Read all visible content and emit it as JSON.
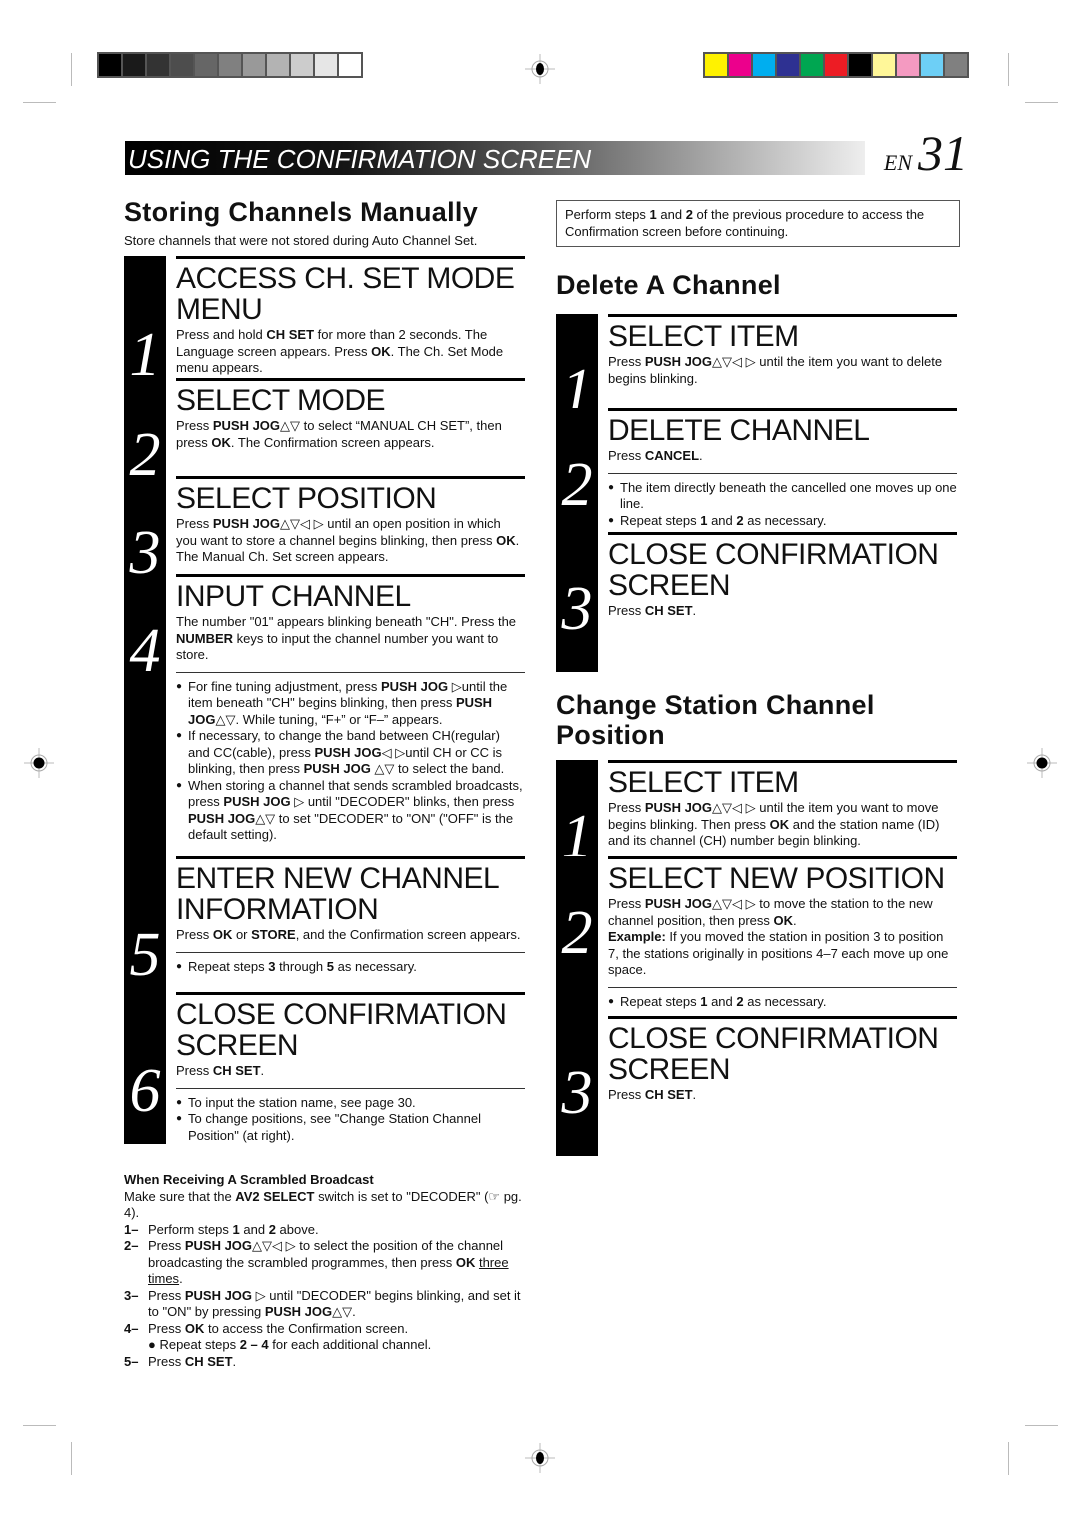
{
  "print_marks": {
    "gray_swatches": [
      "#000000",
      "#1a1a1a",
      "#333333",
      "#4d4d4d",
      "#666666",
      "#808080",
      "#999999",
      "#b3b3b3",
      "#cccccc",
      "#e6e6e6",
      "#ffffff"
    ],
    "color_swatches": [
      "#fff200",
      "#ec008c",
      "#00aeef",
      "#2e3192",
      "#00a651",
      "#ed1c24",
      "#000000",
      "#fff799",
      "#f49ac1",
      "#6dcff6",
      "#808080"
    ]
  },
  "header": {
    "section_title": "USING THE CONFIRMATION SCREEN",
    "lang": "EN",
    "page_number": "31"
  },
  "left": {
    "title": "Storing Channels Manually",
    "intro": "Store channels that were not stored during Auto Channel Set.",
    "steps": [
      {
        "num": "1",
        "title": "ACCESS CH. SET MODE MENU",
        "html": "Press and hold <b>CH SET</b> for more than 2 seconds. The Language screen appears. Press <b>OK</b>. The Ch. Set Mode menu appears."
      },
      {
        "num": "2",
        "title": "SELECT MODE",
        "html": "Press <b>PUSH JOG</b>△▽ to select “MANUAL CH SET”, then press <b>OK</b>. The Confirmation screen appears."
      },
      {
        "num": "3",
        "title": "SELECT POSITION",
        "html": "Press <b>PUSH JOG</b>△▽◁ ▷ until an open position in which you want to store a channel begins blinking, then press <b>OK</b>. The Manual Ch. Set screen appears."
      },
      {
        "num": "4",
        "title": "INPUT CHANNEL",
        "html": "The number \"01\" appears blinking beneath \"CH\". Press the <b>NUMBER</b> keys to input the channel number you want to store.",
        "bullets": [
          "For fine tuning adjustment, press <b>PUSH JOG</b> ▷until the item beneath \"CH\" begins blinking, then press <b>PUSH JOG</b>△▽. While tuning, “F+” or “F–” appears.",
          "If necessary, to change the band between CH(regular) and CC(cable), press <b>PUSH JOG</b>◁ ▷until CH or CC is blinking, then press <b>PUSH JOG</b> △▽ to select the band.",
          "When storing a channel that sends scrambled broadcasts, press <b>PUSH JOG</b> ▷ until \"DECODER\" blinks, then press <b>PUSH JOG</b>△▽ to set \"DECODER\" to \"ON\" (\"OFF\" is the default setting)."
        ]
      },
      {
        "num": "5",
        "title": "ENTER NEW CHANNEL INFORMATION",
        "html": "Press <b>OK</b> or <b>STORE</b>, and the Confirmation screen appears.",
        "bullets": [
          "Repeat steps <b>3</b> through <b>5</b> as necessary."
        ]
      },
      {
        "num": "6",
        "title": "CLOSE CONFIRMATION SCREEN",
        "html": "Press <b>CH SET</b>.",
        "bullets": [
          "To input the station name, see page 30.",
          "To change positions, see \"Change Station Channel Position\" (at right)."
        ]
      }
    ],
    "scrambled": {
      "title": "When Receiving A Scrambled Broadcast",
      "intro_html": "Make sure that the <b>AV2 SELECT</b> switch is set to \"DECODER\" (☞ pg. 4).",
      "items": [
        {
          "k": "1–",
          "html": "Perform steps <b>1</b> and <b>2</b> above."
        },
        {
          "k": "2–",
          "html": "Press <b>PUSH JOG</b>△▽◁ ▷ to select the position of the channel broadcasting the scrambled programmes, then press <b>OK</b> <u>three times</u>."
        },
        {
          "k": "3–",
          "html": "Press <b>PUSH JOG</b> ▷ until \"DECODER\" begins blinking, and set it to \"ON\" by pressing <b>PUSH JOG</b>△▽."
        },
        {
          "k": "4–",
          "html": "Press <b>OK</b> to access the Confirmation screen.<br>● Repeat steps <b>2 – 4</b> for each additional channel."
        },
        {
          "k": "5–",
          "html": "Press <b>CH SET</b>."
        }
      ]
    }
  },
  "right": {
    "note_html": "Perform steps <b>1</b> and <b>2</b> of the previous procedure to access the Confirmation screen before continuing.",
    "delete": {
      "title": "Delete A Channel",
      "steps": [
        {
          "num": "1",
          "title": "SELECT ITEM",
          "html": "Press <b>PUSH JOG</b>△▽◁ ▷ until the item you want to delete begins blinking."
        },
        {
          "num": "2",
          "title": "DELETE CHANNEL",
          "html": "Press <b>CANCEL</b>.",
          "bullets": [
            "The item directly beneath the cancelled one moves up one line.",
            "Repeat steps <b>1</b> and <b>2</b> as necessary."
          ]
        },
        {
          "num": "3",
          "title": "CLOSE CONFIRMATION SCREEN",
          "html": "Press <b>CH SET</b>."
        }
      ]
    },
    "change": {
      "title": "Change Station Channel Position",
      "steps": [
        {
          "num": "1",
          "title": "SELECT ITEM",
          "html": "Press <b>PUSH JOG</b>△▽◁ ▷ until the item you want to move begins blinking. Then press <b>OK</b> and the station name (ID) and its channel (CH) number begin blinking."
        },
        {
          "num": "2",
          "title": "SELECT NEW POSITION",
          "html": "Press <b>PUSH JOG</b>△▽◁ ▷ to move the station to the new channel position, then press <b>OK</b>.<br><b>Example:</b> If you moved the station in position 3 to position 7, the stations originally in positions 4–7 each move up one space.",
          "bullets": [
            "Repeat steps <b>1</b> and <b>2</b> as necessary."
          ]
        },
        {
          "num": "3",
          "title": "CLOSE CONFIRMATION SCREEN",
          "html": "Press <b>CH SET</b>."
        }
      ]
    }
  }
}
